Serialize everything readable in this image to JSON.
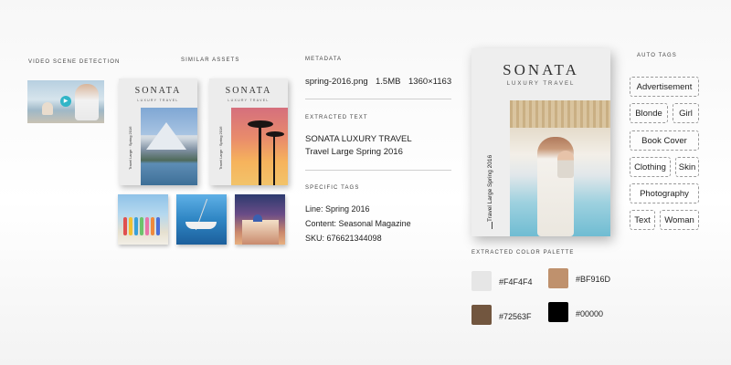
{
  "video": {
    "label": "VIDEO SCENE DETECTION"
  },
  "similar": {
    "label": "SIMILAR ASSETS",
    "book_brand": "SONATA",
    "book_sub": "LUXURY TRAVEL",
    "book_spine": "Travel Large · Spring 2016"
  },
  "metadata": {
    "label": "METADATA",
    "filename": "spring-2016.png",
    "filesize": "1.5MB",
    "dimensions": "1360×1163"
  },
  "extracted_text": {
    "label": "EXTRACTED TEXT",
    "line1": "SONATA LUXURY TRAVEL",
    "line2": "Travel Large Spring 2016"
  },
  "specific_tags": {
    "label": "SPECIFIC TAGS",
    "line": "Line: Spring 2016",
    "content": "Content: Seasonal Magazine",
    "sku": "SKU: 676621344098"
  },
  "cover": {
    "brand": "SONATA",
    "sub": "LUXURY TRAVEL",
    "spine": "Travel Large   Spring 2016"
  },
  "palette": {
    "label": "EXTRACTED COLOR PALETTE",
    "colors": [
      {
        "hex": "#F4F4F4",
        "label": "#F4F4F4"
      },
      {
        "hex": "#BF916D",
        "label": "#BF916D"
      },
      {
        "hex": "#72563F",
        "label": "#72563F"
      },
      {
        "hex": "#000000",
        "label": "#00000"
      }
    ]
  },
  "auto_tags": {
    "label": "AUTO TAGS",
    "items": [
      "Advertisement",
      "Blonde",
      "Girl",
      "Book Cover",
      "Clothing",
      "Skin",
      "Photography",
      "Text",
      "Woman"
    ]
  }
}
